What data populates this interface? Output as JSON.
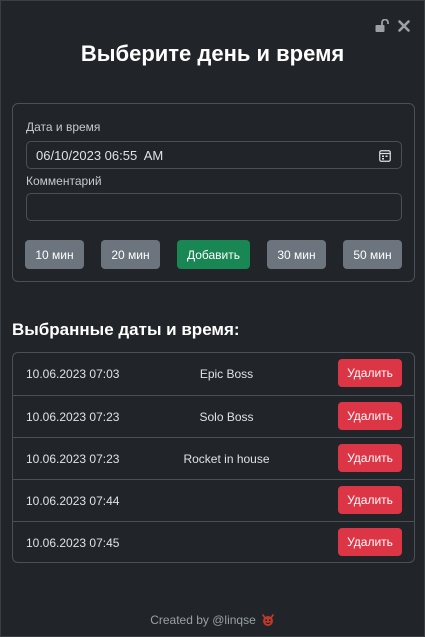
{
  "header": {
    "title": "Выберите день и время",
    "unlock_icon": "unlock-icon",
    "close_icon": "close-icon"
  },
  "form": {
    "datetime_label": "Дата и время",
    "datetime_value": "06/10/2023 06:55  AM",
    "comment_label": "Комментарий",
    "comment_value": "",
    "buttons": {
      "min10": "10 мин",
      "min20": "20 мин",
      "add": "Добавить",
      "min30": "30 мин",
      "min50": "50 мин"
    }
  },
  "selected": {
    "title": "Выбранные даты и время:",
    "delete_label": "Удалить",
    "rows": [
      {
        "date": "10.06.2023 07:03",
        "name": "Epic Boss"
      },
      {
        "date": "10.06.2023 07:23",
        "name": "Solo Boss"
      },
      {
        "date": "10.06.2023 07:23",
        "name": "Rocket in house"
      },
      {
        "date": "10.06.2023 07:44",
        "name": ""
      },
      {
        "date": "10.06.2023 07:45",
        "name": ""
      }
    ]
  },
  "footer": {
    "text": "Created by @linqse"
  },
  "colors": {
    "background": "#212529",
    "border": "#495057",
    "gray_button": "#6c757d",
    "green_button": "#198754",
    "red_button": "#dc3545"
  }
}
